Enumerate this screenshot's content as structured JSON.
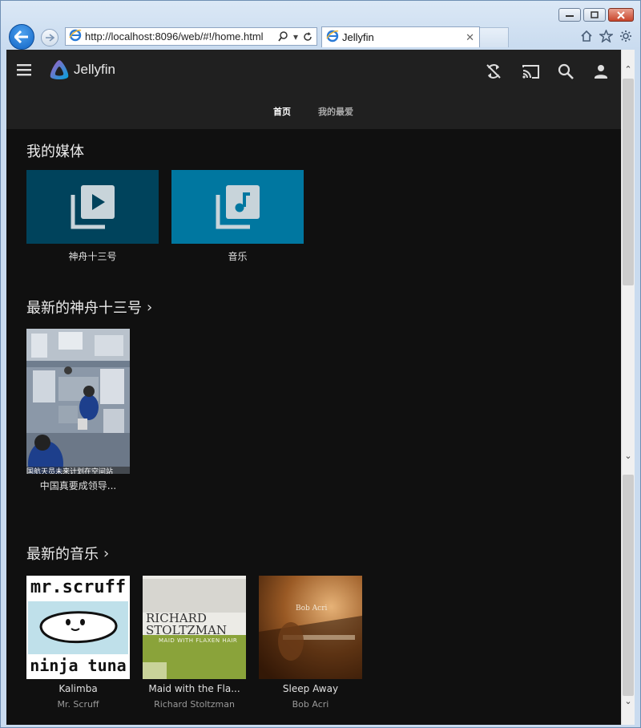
{
  "browser": {
    "url": "http://localhost:8096/web/#!/home.html",
    "tab_title": "Jellyfin"
  },
  "app": {
    "logo_text": "Jellyfin",
    "header_icons": [
      "sync-disabled-icon",
      "cast-icon",
      "search-icon",
      "user-icon"
    ]
  },
  "tabs": [
    {
      "label": "首页",
      "active": true
    },
    {
      "label": "我的最爱",
      "active": false
    }
  ],
  "sections": {
    "my_media": "我的媒体",
    "latest_shenzhou": "最新的神舟十三号",
    "latest_music": "最新的音乐"
  },
  "libraries": [
    {
      "label": "神舟十三号",
      "icon": "video-library-icon",
      "color": "#00435c"
    },
    {
      "label": "音乐",
      "icon": "music-library-icon",
      "color": "#0077a0"
    }
  ],
  "latest_videos": [
    {
      "title": "中国真要成领导...",
      "overlay_text": "国航天员未来计划在空间站"
    }
  ],
  "latest_music": [
    {
      "title": "Kalimba",
      "artist": "Mr. Scruff",
      "cover_text": [
        "mr.scruff",
        "ninja tuna"
      ]
    },
    {
      "title": "Maid with the Fla...",
      "artist": "Richard Stoltzman",
      "cover_text": [
        "RICHARD",
        "STOLTZMAN",
        "MAID WITH FLAXEN HAIR"
      ]
    },
    {
      "title": "Sleep Away",
      "artist": "Bob Acri",
      "cover_text": [
        "Bob Acri"
      ]
    }
  ],
  "colors": {
    "header_bg": "#202020",
    "page_bg": "#101010",
    "accent_tab": "#ffffff"
  }
}
